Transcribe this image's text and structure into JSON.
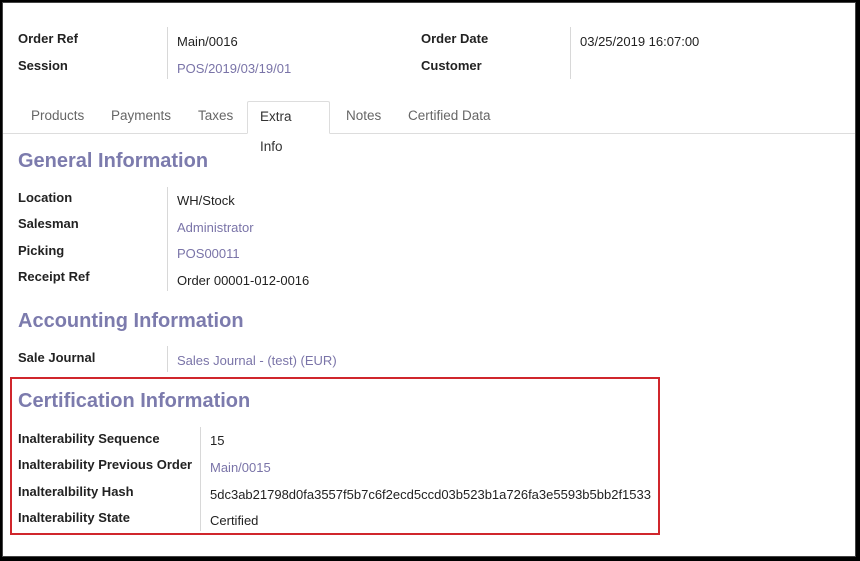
{
  "header": {
    "order_ref_label": "Order Ref",
    "order_ref_value": "Main/0016",
    "session_label": "Session",
    "session_value": "POS/2019/03/19/01",
    "order_date_label": "Order Date",
    "order_date_value": "03/25/2019 16:07:00",
    "customer_label": "Customer",
    "customer_value": ""
  },
  "tabs": [
    {
      "label": "Products",
      "active": false
    },
    {
      "label": "Payments",
      "active": false
    },
    {
      "label": "Taxes",
      "active": false
    },
    {
      "label": "Extra Info",
      "active": true
    },
    {
      "label": "Notes",
      "active": false
    },
    {
      "label": "Certified Data",
      "active": false
    }
  ],
  "general": {
    "title": "General Information",
    "location_label": "Location",
    "location_value": "WH/Stock",
    "salesman_label": "Salesman",
    "salesman_value": "Administrator",
    "picking_label": "Picking",
    "picking_value": "POS00011",
    "receipt_ref_label": "Receipt Ref",
    "receipt_ref_value": "Order 00001-012-0016"
  },
  "accounting": {
    "title": "Accounting Information",
    "sale_journal_label": "Sale Journal",
    "sale_journal_value": "Sales Journal - (test) (EUR)"
  },
  "certification": {
    "title": "Certification Information",
    "sequence_label": "Inalterability Sequence",
    "sequence_value": "15",
    "previous_order_label": "Inalterability Previous Order",
    "previous_order_value": "Main/0015",
    "hash_label": "Inalteralbility Hash",
    "hash_value": "5dc3ab21798d0fa3557f5b7c6f2ecd5ccd03b523b1a726fa3e5593b5bb2f1533",
    "state_label": "Inalterability State",
    "state_value": "Certified"
  },
  "colors": {
    "section_title": "#7c7bad",
    "link": "#7a74a8",
    "highlight_border": "#d0262c"
  }
}
